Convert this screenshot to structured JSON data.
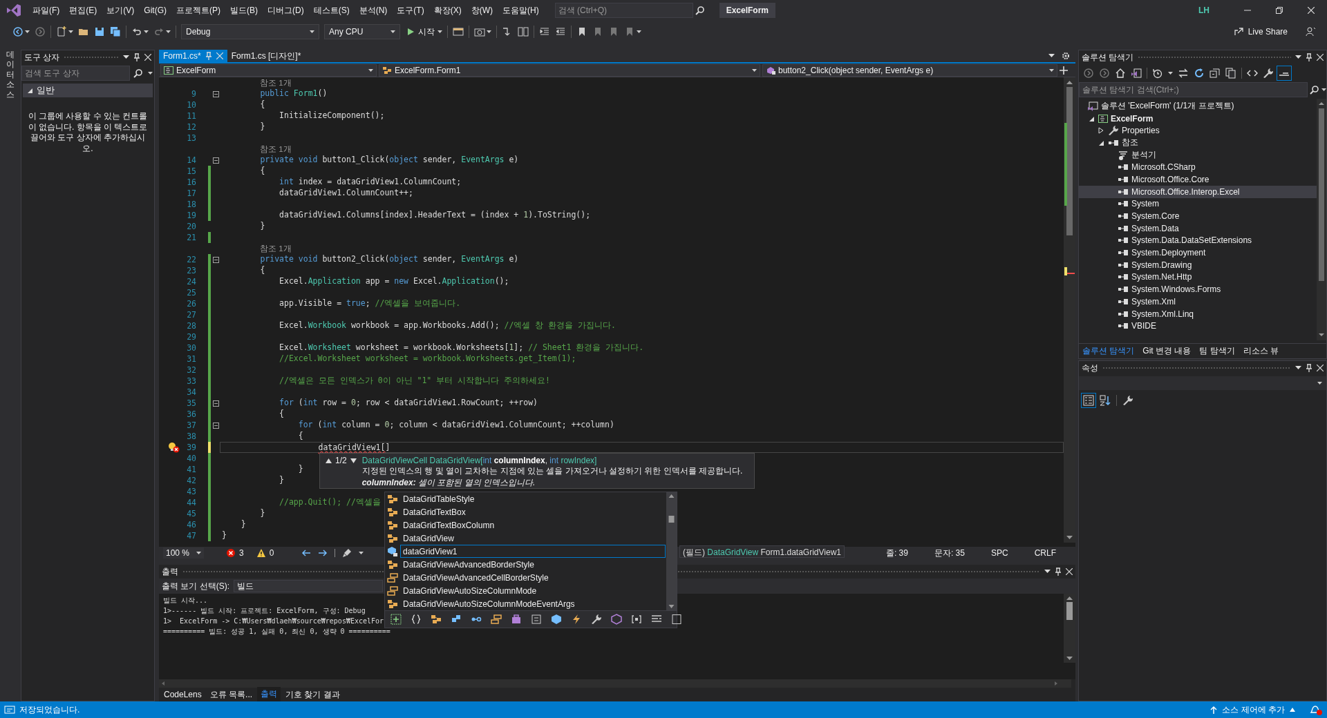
{
  "menu_bar": {
    "items": [
      "파일(F)",
      "편집(E)",
      "보기(V)",
      "Git(G)",
      "프로젝트(P)",
      "빌드(B)",
      "디버그(D)",
      "테스트(S)",
      "분석(N)",
      "도구(T)",
      "확장(X)",
      "창(W)",
      "도움말(H)"
    ],
    "search": {
      "placeholder": "검색 (Ctrl+Q)"
    },
    "solution_name": "ExcelForm",
    "user_initials": "LH"
  },
  "toolbar": {
    "configuration": "Debug",
    "platform": "Any CPU",
    "start": "시작",
    "live_share": "Live Share"
  },
  "side_strip": {
    "tab": "데이터 소스"
  },
  "toolbox": {
    "title": "도구 상자",
    "search": {
      "placeholder": "검색 도구 상자"
    },
    "group": {
      "label": "일반",
      "expanded": true
    },
    "empty_message": "이 그룹에 사용할 수 있는 컨트롤이 없습니다. 항목을 이 텍스트로 끌어와 도구 상자에 추가하십시오."
  },
  "editor": {
    "tabs": [
      {
        "label": "Form1.cs*",
        "selected": true
      },
      {
        "label": "Form1.cs [디자인]*",
        "selected": false
      }
    ],
    "navigation": [
      "ExcelForm",
      "ExcelForm.Form1",
      "button2_Click(object sender, EventArgs e)"
    ],
    "lines": [
      {
        "kind": "codelens",
        "text": "참조 1개"
      },
      {
        "kind": "code",
        "number": "9",
        "fold": true,
        "current": false,
        "tokens": [
          {
            "text": "        public ",
            "kind": "keyword"
          },
          {
            "text": "Form1",
            "kind": "type"
          },
          {
            "text": "()",
            "kind": "plain"
          }
        ]
      },
      {
        "kind": "code",
        "number": "10",
        "fold": false,
        "current": false,
        "tokens": [
          {
            "text": "        {",
            "kind": "plain"
          }
        ]
      },
      {
        "kind": "code",
        "number": "11",
        "fold": false,
        "current": false,
        "tokens": [
          {
            "text": "            InitializeComponent();",
            "kind": "plain"
          }
        ]
      },
      {
        "kind": "code",
        "number": "12",
        "fold": false,
        "current": false,
        "tokens": [
          {
            "text": "        }",
            "kind": "plain"
          }
        ]
      },
      {
        "kind": "code",
        "number": "13",
        "fold": false,
        "current": false
      },
      {
        "kind": "codelens",
        "text": "참조 1개"
      },
      {
        "kind": "code",
        "number": "14",
        "fold": true,
        "current": false,
        "tokens": [
          {
            "text": "        private void ",
            "kind": "keyword"
          },
          {
            "text": "button1_Click(",
            "kind": "plain"
          },
          {
            "text": "object",
            "kind": "keyword"
          },
          {
            "text": " sender, ",
            "kind": "plain"
          },
          {
            "text": "EventArgs",
            "kind": "type"
          },
          {
            "text": " e)",
            "kind": "plain"
          }
        ]
      },
      {
        "kind": "code",
        "number": "15",
        "fold": false,
        "current": false,
        "color": "#57a64a",
        "tokens": [
          {
            "text": "        {",
            "kind": "plain"
          }
        ]
      },
      {
        "kind": "code",
        "number": "16",
        "fold": false,
        "current": false,
        "color": "#57a64a",
        "tokens": [
          {
            "text": "            int",
            "kind": "keyword"
          },
          {
            "text": " index = dataGridView1.ColumnCount;",
            "kind": "plain"
          }
        ]
      },
      {
        "kind": "code",
        "number": "17",
        "fold": false,
        "current": false,
        "color": "#57a64a",
        "tokens": [
          {
            "text": "            dataGridView1.ColumnCount++;",
            "kind": "plain"
          }
        ]
      },
      {
        "kind": "code",
        "number": "18",
        "fold": false,
        "current": false,
        "color": "#57a64a"
      },
      {
        "kind": "code",
        "number": "19",
        "fold": false,
        "current": false,
        "color": "#57a64a",
        "tokens": [
          {
            "text": "            dataGridView1.Columns[index].HeaderText = (index + ",
            "kind": "plain"
          },
          {
            "text": "1",
            "kind": "number"
          },
          {
            "text": ").ToString();",
            "kind": "plain"
          }
        ]
      },
      {
        "kind": "code",
        "number": "20",
        "fold": false,
        "current": false,
        "tokens": [
          {
            "text": "        }",
            "kind": "plain"
          }
        ]
      },
      {
        "kind": "code",
        "number": "21",
        "fold": false,
        "current": false,
        "color": "#57a64a"
      },
      {
        "kind": "codelens",
        "text": "참조 1개"
      },
      {
        "kind": "code",
        "number": "22",
        "fold": true,
        "current": false,
        "color": "#57a64a",
        "tokens": [
          {
            "text": "        private void ",
            "kind": "keyword"
          },
          {
            "text": "button2_Click(",
            "kind": "plain"
          },
          {
            "text": "object",
            "kind": "keyword"
          },
          {
            "text": " sender, ",
            "kind": "plain"
          },
          {
            "text": "EventArgs",
            "kind": "type"
          },
          {
            "text": " e)",
            "kind": "plain"
          }
        ]
      },
      {
        "kind": "code",
        "number": "23",
        "fold": false,
        "current": false,
        "color": "#57a64a",
        "tokens": [
          {
            "text": "        {",
            "kind": "plain"
          }
        ]
      },
      {
        "kind": "code",
        "number": "24",
        "fold": false,
        "current": false,
        "color": "#57a64a",
        "tokens": [
          {
            "text": "            Excel.",
            "kind": "plain"
          },
          {
            "text": "Application",
            "kind": "type"
          },
          {
            "text": " app = ",
            "kind": "plain"
          },
          {
            "text": "new",
            "kind": "keyword"
          },
          {
            "text": " Excel.",
            "kind": "plain"
          },
          {
            "text": "Application",
            "kind": "type"
          },
          {
            "text": "();",
            "kind": "plain"
          }
        ]
      },
      {
        "kind": "code",
        "number": "25",
        "fold": false,
        "current": false,
        "color": "#57a64a"
      },
      {
        "kind": "code",
        "number": "26",
        "fold": false,
        "current": false,
        "color": "#57a64a",
        "tokens": [
          {
            "text": "            app.Visible = ",
            "kind": "plain"
          },
          {
            "text": "true",
            "kind": "keyword"
          },
          {
            "text": "; ",
            "kind": "plain"
          },
          {
            "text": "//엑셀을 보여줍니다.",
            "kind": "comment"
          }
        ]
      },
      {
        "kind": "code",
        "number": "27",
        "fold": false,
        "current": false,
        "color": "#57a64a"
      },
      {
        "kind": "code",
        "number": "28",
        "fold": false,
        "current": false,
        "color": "#57a64a",
        "tokens": [
          {
            "text": "            Excel.",
            "kind": "plain"
          },
          {
            "text": "Workbook",
            "kind": "type"
          },
          {
            "text": " workbook = app.Workbooks.Add(); ",
            "kind": "plain"
          },
          {
            "text": "//엑셀 창 환경을 가집니다.",
            "kind": "comment"
          }
        ]
      },
      {
        "kind": "code",
        "number": "29",
        "fold": false,
        "current": false,
        "color": "#57a64a"
      },
      {
        "kind": "code",
        "number": "30",
        "fold": false,
        "current": false,
        "color": "#57a64a",
        "tokens": [
          {
            "text": "            Excel.",
            "kind": "plain"
          },
          {
            "text": "Worksheet",
            "kind": "type"
          },
          {
            "text": " worksheet = workbook.Worksheets[",
            "kind": "plain"
          },
          {
            "text": "1",
            "kind": "number"
          },
          {
            "text": "]; ",
            "kind": "plain"
          },
          {
            "text": "// Sheet1 환경을 가집니다.",
            "kind": "comment"
          }
        ]
      },
      {
        "kind": "code",
        "number": "31",
        "fold": false,
        "current": false,
        "color": "#57a64a",
        "tokens": [
          {
            "text": "            //Excel.Worksheet worksheet = workbook.Worksheets.get_Item(1);",
            "kind": "comment"
          }
        ]
      },
      {
        "kind": "code",
        "number": "32",
        "fold": false,
        "current": false,
        "color": "#57a64a"
      },
      {
        "kind": "code",
        "number": "33",
        "fold": false,
        "current": false,
        "color": "#57a64a",
        "tokens": [
          {
            "text": "            //엑셀은 모든 인덱스가 0이 아닌 \"1\" 부터 시작합니다 주의하세요!",
            "kind": "comment"
          }
        ]
      },
      {
        "kind": "code",
        "number": "34",
        "fold": false,
        "current": false,
        "color": "#57a64a"
      },
      {
        "kind": "code",
        "number": "35",
        "fold": true,
        "current": false,
        "color": "#57a64a",
        "tokens": [
          {
            "text": "            for",
            "kind": "keyword"
          },
          {
            "text": " (",
            "kind": "plain"
          },
          {
            "text": "int",
            "kind": "keyword"
          },
          {
            "text": " row = ",
            "kind": "plain"
          },
          {
            "text": "0",
            "kind": "number"
          },
          {
            "text": "; row < dataGridView1.RowCount; ++row)",
            "kind": "plain"
          }
        ]
      },
      {
        "kind": "code",
        "number": "36",
        "fold": false,
        "current": false,
        "color": "#57a64a",
        "tokens": [
          {
            "text": "            {",
            "kind": "plain"
          }
        ]
      },
      {
        "kind": "code",
        "number": "37",
        "fold": true,
        "current": false,
        "color": "#57a64a",
        "tokens": [
          {
            "text": "                for",
            "kind": "keyword"
          },
          {
            "text": " (",
            "kind": "plain"
          },
          {
            "text": "int",
            "kind": "keyword"
          },
          {
            "text": " column = ",
            "kind": "plain"
          },
          {
            "text": "0",
            "kind": "number"
          },
          {
            "text": "; column < dataGridView1.ColumnCount; ++column)",
            "kind": "plain"
          }
        ]
      },
      {
        "kind": "code",
        "number": "38",
        "fold": false,
        "current": false,
        "color": "#57a64a",
        "tokens": [
          {
            "text": "                {",
            "kind": "plain"
          }
        ]
      },
      {
        "kind": "code",
        "number": "39",
        "fold": false,
        "current": true,
        "color": "#efe06a",
        "lightbulb": true,
        "tokens": [
          {
            "text": "                    dataGridView1[",
            "kind": "error"
          },
          {
            "text": "]",
            "kind": "plain"
          }
        ]
      },
      {
        "kind": "code",
        "number": "40",
        "fold": false,
        "current": false,
        "color": "#57a64a"
      },
      {
        "kind": "code",
        "number": "41",
        "fold": false,
        "current": false,
        "color": "#57a64a",
        "tokens": [
          {
            "text": "                }",
            "kind": "plain"
          }
        ]
      },
      {
        "kind": "code",
        "number": "42",
        "fold": false,
        "current": false,
        "color": "#57a64a",
        "tokens": [
          {
            "text": "            }",
            "kind": "plain"
          }
        ]
      },
      {
        "kind": "code",
        "number": "43",
        "fold": false,
        "current": false,
        "color": "#57a64a"
      },
      {
        "kind": "code",
        "number": "44",
        "fold": false,
        "current": false,
        "color": "#57a64a",
        "tokens": [
          {
            "text": "            //app.Quit(); //엑셀을",
            "kind": "comment"
          }
        ]
      },
      {
        "kind": "code",
        "number": "45",
        "fold": false,
        "current": false,
        "color": "#57a64a",
        "tokens": [
          {
            "text": "        }",
            "kind": "plain"
          }
        ]
      },
      {
        "kind": "code",
        "number": "46",
        "fold": false,
        "current": false,
        "color": "#57a64a",
        "tokens": [
          {
            "text": "    }",
            "kind": "plain"
          }
        ]
      },
      {
        "kind": "code",
        "number": "47",
        "fold": false,
        "current": false,
        "color": "#57a64a",
        "tokens": [
          {
            "text": "}",
            "kind": "plain"
          }
        ]
      }
    ],
    "parameter_info": {
      "counter": "1/2",
      "signature": [
        {
          "text": "DataGridViewCell DataGridView[",
          "kind": "type"
        },
        {
          "text": "int",
          "kind": "keyword"
        },
        {
          "text": " columnIndex",
          "kind": "current_parameter"
        },
        {
          "text": ", ",
          "kind": "plain"
        },
        {
          "text": "int",
          "kind": "keyword"
        },
        {
          "text": " rowIndex]",
          "kind": "type"
        }
      ],
      "description": "지정된 인덱스의 행 및 열이 교차하는 지점에 있는 셀을 가져오거나 설정하기 위한 인덱서를 제공합니다.",
      "parameter": "**columnIndex:** 셀이 포함된 열의 인덱스입니다."
    },
    "completion": [
      {
        "label": "DataGridTableStyle",
        "kind": "class",
        "selected": false
      },
      {
        "label": "DataGridTextBox",
        "kind": "class",
        "selected": false
      },
      {
        "label": "DataGridTextBoxColumn",
        "kind": "class",
        "selected": false
      },
      {
        "label": "DataGridView",
        "kind": "class",
        "selected": false
      },
      {
        "label": "dataGridView1",
        "kind": "field",
        "selected": true
      },
      {
        "label": "DataGridViewAdvancedBorderStyle",
        "kind": "class",
        "selected": false
      },
      {
        "label": "DataGridViewAdvancedCellBorderStyle",
        "kind": "enum",
        "selected": false
      },
      {
        "label": "DataGridViewAutoSizeColumnMode",
        "kind": "enum",
        "selected": false
      },
      {
        "label": "DataGridViewAutoSizeColumnModeEventArgs",
        "kind": "class",
        "selected": false
      }
    ],
    "quick_info": [
      {
        "text": "(필드) ",
        "kind": "plain"
      },
      {
        "text": "DataGridView",
        "kind": "type"
      },
      {
        "text": " Form1.dataGridView1",
        "kind": "plain"
      }
    ],
    "status": {
      "zoom": "100 %",
      "errors": "3",
      "warnings": "0",
      "line": "줄: 39",
      "column": "문자: 35",
      "whitespace": "SPC",
      "line_ending": "CRLF"
    }
  },
  "output": {
    "title": "출력",
    "source_label": "출력 보기 선택(S):",
    "source": "빌드",
    "lines": [
      "빌드 시작...",
      "1>------ 빌드 시작: 프로젝트: ExcelForm, 구성: Debug",
      "1>  ExcelForm -> C:₩Users₩dlaeh₩source₩repos₩ExcelFor",
      "========== 빌드: 성공 1, 실패 0, 최신 0, 생략 0 =========="
    ],
    "tabs": [
      {
        "label": "CodeLens",
        "selected": false
      },
      {
        "label": "오류 목록...",
        "selected": false
      },
      {
        "label": "출력",
        "selected": true
      },
      {
        "label": "기호 찾기 결과",
        "selected": false
      }
    ]
  },
  "solution_explorer": {
    "title": "솔루션 탐색기",
    "search": {
      "placeholder": "솔루션 탐색기 검색(Ctrl+;)"
    },
    "tree": [
      {
        "label": "솔루션 'ExcelForm' (1/1개 프로젝트)",
        "kind": "solution",
        "selected": false,
        "children": [
          {
            "label": "ExcelForm",
            "kind": "project",
            "selected": false,
            "expanded": true,
            "children": [
              {
                "label": "Properties",
                "kind": "properties",
                "selected": false,
                "expanded": false
              },
              {
                "label": "참조",
                "kind": "references",
                "selected": false,
                "expanded": true,
                "children": [
                  {
                    "label": "분석기",
                    "kind": "analyzer",
                    "selected": false
                  },
                  {
                    "label": "Microsoft.CSharp",
                    "kind": "reference",
                    "selected": false
                  },
                  {
                    "label": "Microsoft.Office.Core",
                    "kind": "reference",
                    "selected": false
                  },
                  {
                    "label": "Microsoft.Office.Interop.Excel",
                    "kind": "reference",
                    "selected": true
                  },
                  {
                    "label": "System",
                    "kind": "reference",
                    "selected": false
                  },
                  {
                    "label": "System.Core",
                    "kind": "reference",
                    "selected": false
                  },
                  {
                    "label": "System.Data",
                    "kind": "reference",
                    "selected": false
                  },
                  {
                    "label": "System.Data.DataSetExtensions",
                    "kind": "reference",
                    "selected": false
                  },
                  {
                    "label": "System.Deployment",
                    "kind": "reference",
                    "selected": false
                  },
                  {
                    "label": "System.Drawing",
                    "kind": "reference",
                    "selected": false
                  },
                  {
                    "label": "System.Net.Http",
                    "kind": "reference",
                    "selected": false
                  },
                  {
                    "label": "System.Windows.Forms",
                    "kind": "reference",
                    "selected": false
                  },
                  {
                    "label": "System.Xml",
                    "kind": "reference",
                    "selected": false
                  },
                  {
                    "label": "System.Xml.Linq",
                    "kind": "reference",
                    "selected": false
                  },
                  {
                    "label": "VBIDE",
                    "kind": "reference",
                    "selected": false
                  }
                ]
              }
            ]
          }
        ]
      }
    ],
    "tabs": [
      {
        "label": "솔루션 탐색기",
        "selected": true
      },
      {
        "label": "Git 변경 내용",
        "selected": false
      },
      {
        "label": "팀 탐색기",
        "selected": false
      },
      {
        "label": "리소스 뷰",
        "selected": false
      }
    ]
  },
  "properties": {
    "title": "속성"
  },
  "status_bar": {
    "message": "저장되었습니다.",
    "source_control": "소스 제어에 추가"
  }
}
